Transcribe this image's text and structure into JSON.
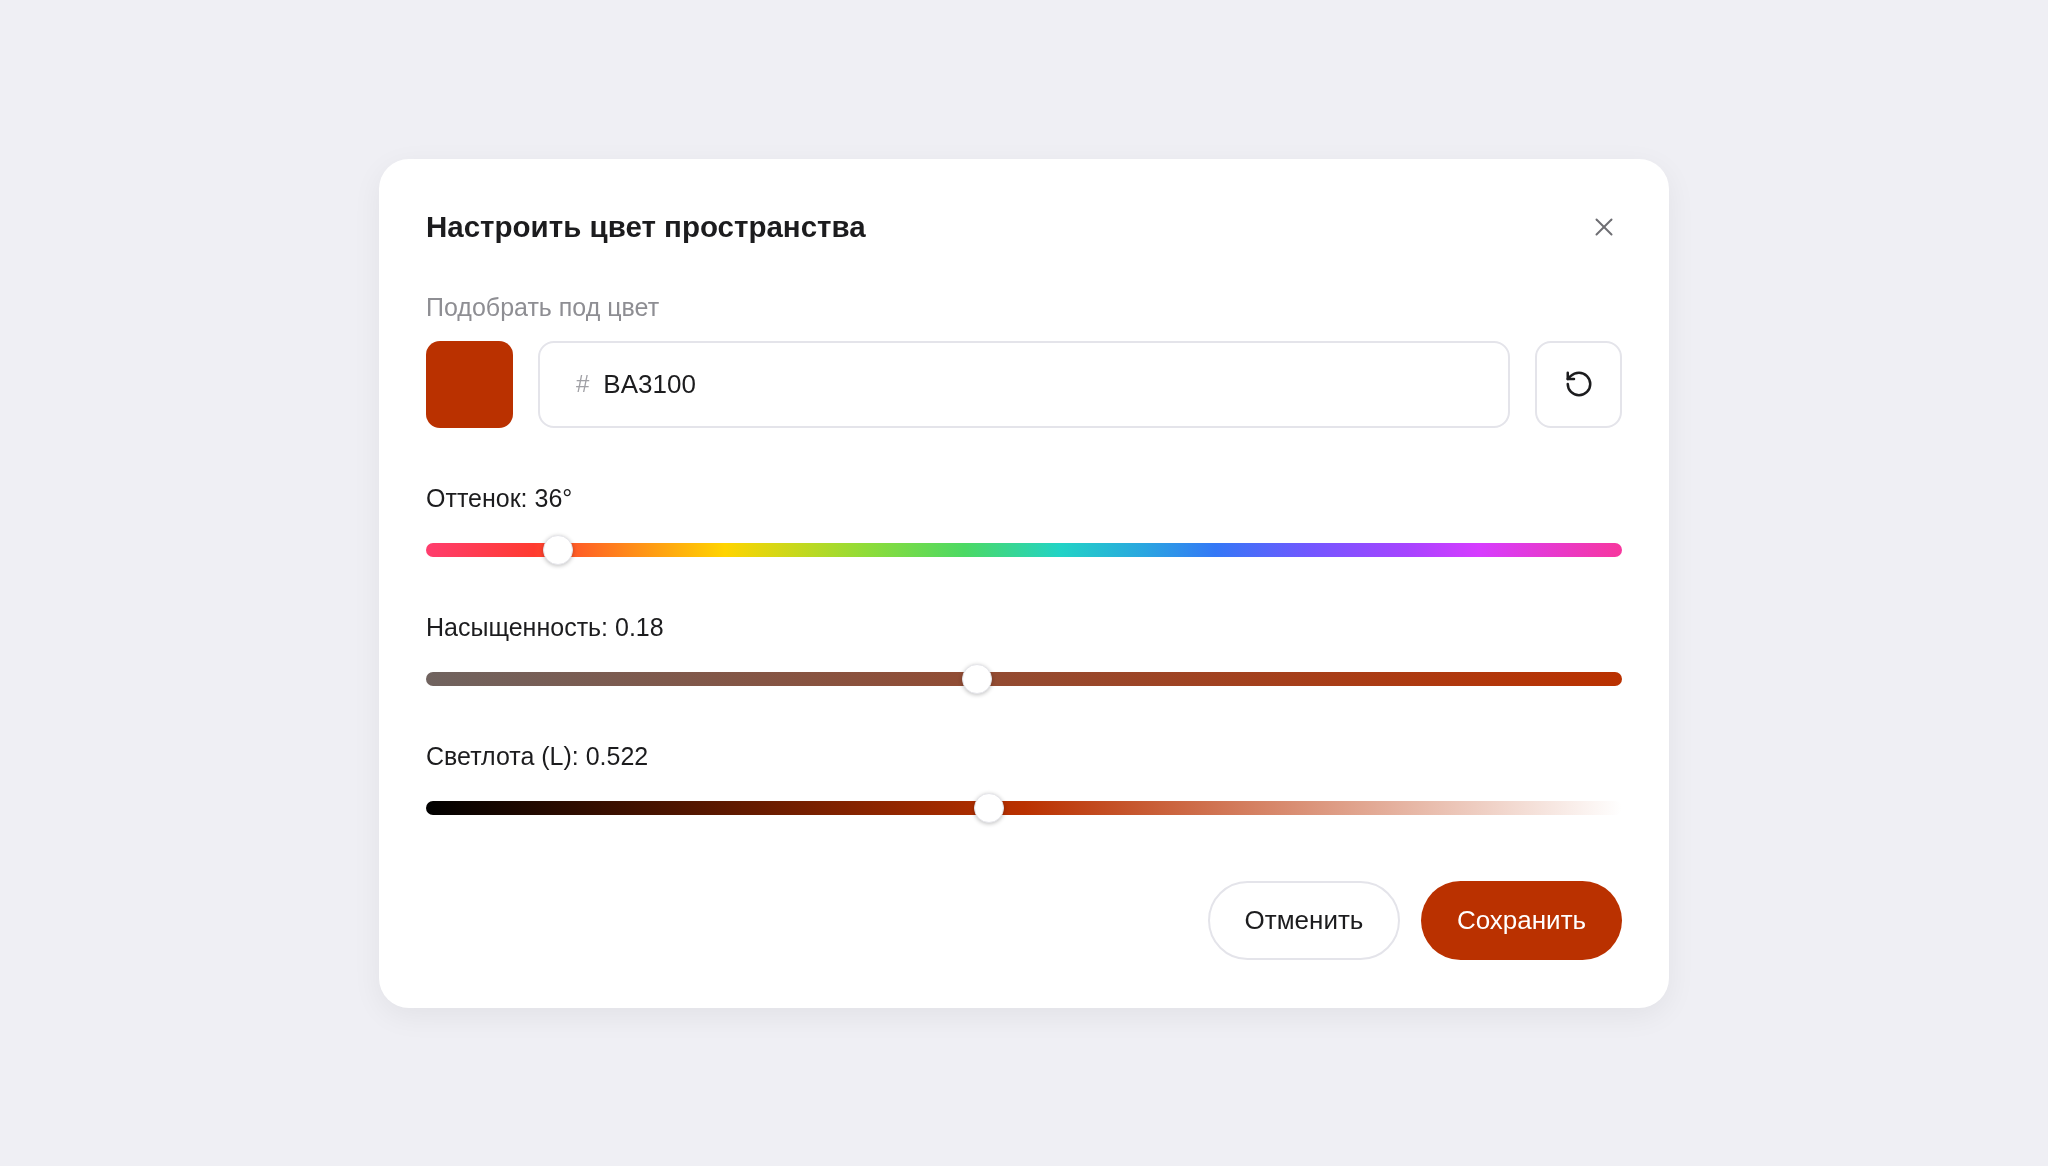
{
  "dialog": {
    "title": "Настроить цвет пространства"
  },
  "color_field": {
    "label": "Подобрать под цвет",
    "color": "#ba3100",
    "prefix": "#",
    "value": "BA3100"
  },
  "sliders": [
    {
      "kind": "hue",
      "label": "Оттенок: 36°",
      "level": 0.1
    },
    {
      "kind": "saturation",
      "label": "Насыщенность: 0.18",
      "level": 0.46
    },
    {
      "kind": "lightness",
      "label": "Светлота (L): 0.522",
      "level": 0.47
    }
  ],
  "buttons": [
    {
      "kind": "secondary",
      "label": "Отменить"
    },
    {
      "kind": "primary",
      "label": "Сохранить"
    }
  ]
}
